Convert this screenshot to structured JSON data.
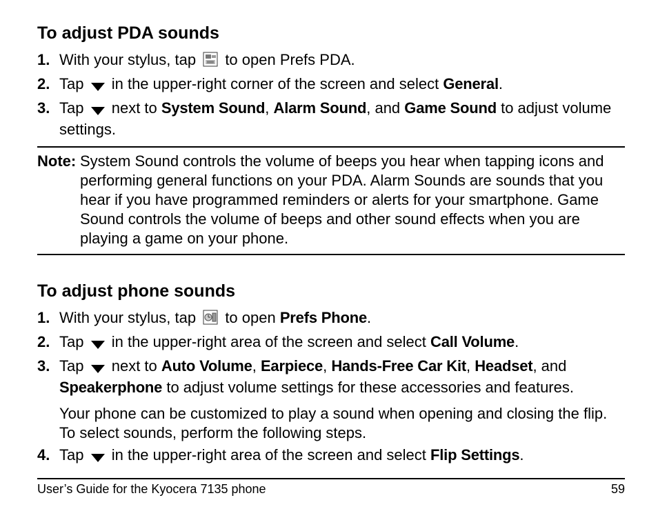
{
  "section1": {
    "heading": "To adjust PDA sounds",
    "steps": [
      {
        "num": "1.",
        "pre": "With your stylus, tap ",
        "post": " to open Prefs PDA."
      },
      {
        "num": "2.",
        "pre": "Tap ",
        "post_a": " in the upper-right corner of the screen and select ",
        "bold_a": "General",
        "post_b": "."
      },
      {
        "num": "3.",
        "pre": "Tap ",
        "post_a": " next to ",
        "bold_a": "System Sound",
        "sep_a": ", ",
        "bold_b": "Alarm Sound",
        "sep_b": ", and ",
        "bold_c": "Game Sound",
        "post_b": " to adjust volume settings."
      }
    ]
  },
  "note": {
    "label": "Note:",
    "body": "System Sound controls the volume of beeps you hear when tapping icons and performing general functions on your PDA. Alarm Sounds are sounds that you hear if you have programmed reminders or alerts for your smartphone. Game Sound controls the volume of beeps and other sound effects when you are playing a game on your phone."
  },
  "section2": {
    "heading": "To adjust phone sounds",
    "steps": [
      {
        "num": "1.",
        "pre": "With your stylus, tap ",
        "post_a": " to open ",
        "bold_a": "Prefs Phone",
        "post_b": "."
      },
      {
        "num": "2.",
        "pre": "Tap ",
        "post_a": " in the upper-right area of the screen and select ",
        "bold_a": "Call Volume",
        "post_b": "."
      },
      {
        "num": "3.",
        "pre": "Tap ",
        "post_a": " next to ",
        "bold_a": "Auto Volume",
        "sep_a": ", ",
        "bold_b": "Earpiece",
        "sep_b": ", ",
        "bold_c": "Hands-Free Car Kit",
        "sep_c": ", ",
        "bold_d": "Headset",
        "sep_d": ", and ",
        "bold_e": "Speakerphone",
        "post_b": " to adjust volume settings for these accessories and features."
      }
    ],
    "sub_para": "Your phone can be customized to play a sound when opening and closing the flip. To select sounds, perform the following steps.",
    "step4": {
      "num": "4.",
      "pre": "Tap ",
      "post_a": " in the upper-right area of the screen and select ",
      "bold_a": "Flip Settings",
      "post_b": "."
    }
  },
  "footer": {
    "left": "User’s Guide for the Kyocera 7135 phone",
    "right": "59"
  }
}
